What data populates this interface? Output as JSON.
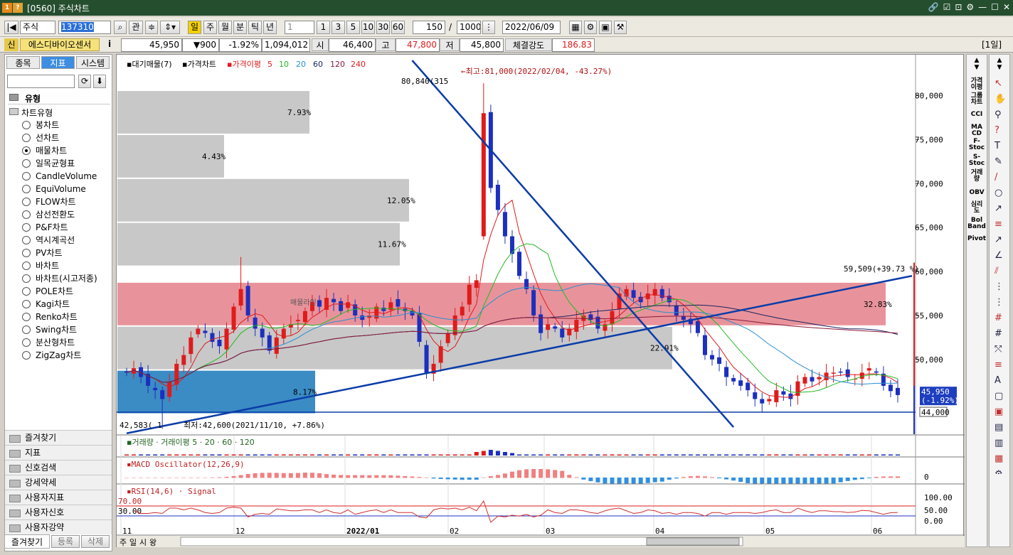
{
  "window": {
    "title": "[0560] 주식차트"
  },
  "toolbar": {
    "market": "주식",
    "code": "137310",
    "btn_gwan": "관",
    "periods": [
      "일",
      "주",
      "월",
      "분",
      "틱",
      "년"
    ],
    "unit_value": "1",
    "quick_units": [
      "1",
      "3",
      "5",
      "10",
      "30",
      "60"
    ],
    "count": "150",
    "total": "1000",
    "date": "2022/06/09"
  },
  "quote": {
    "badge": "신",
    "name": "에스디바이오센서",
    "info": "i",
    "price": "45,950",
    "change": "▼900",
    "change_pct": "-1.92%",
    "volume": "1,094,012",
    "open_label": "시",
    "open": "46,400",
    "high_label": "고",
    "high": "47,800",
    "low_label": "저",
    "low": "45,800",
    "strength_label": "체결강도",
    "strength": "186.83",
    "period_tag": "[1일]"
  },
  "sidebar": {
    "tabs": [
      "종목",
      "지표",
      "시스템"
    ],
    "section": "유형",
    "subsection": "차트유형",
    "chart_types": [
      "봉차트",
      "선차트",
      "매물차트",
      "일목균형표",
      "CandleVolume",
      "EquiVolume",
      "FLOW차트",
      "삼선전환도",
      "P&F차트",
      "역시계곡선",
      "PV차트",
      "바차트",
      "바차트(시고저종)",
      "POLE차트",
      "Kagi차트",
      "Renko차트",
      "Swing차트",
      "분산형차트",
      "ZigZag차트"
    ],
    "selected_index": 2,
    "folders": [
      "즐겨찾기",
      "지표",
      "신호검색",
      "강세약세",
      "사용자지표",
      "사용자신호",
      "사용자강약"
    ],
    "bottom_buttons": [
      "즐겨찾기",
      "등록",
      "삭제"
    ]
  },
  "chart_data": {
    "type": "candlestick",
    "legend": {
      "vp": "대기매물(7)",
      "price": "가격차트",
      "ma": "가격이평",
      "ma_periods": [
        "5",
        "10",
        "20",
        "60",
        "120",
        "240"
      ]
    },
    "y_ticks": [
      "80,000",
      "75,000",
      "70,000",
      "65,000",
      "60,000",
      "55,000",
      "50,000"
    ],
    "ylim": [
      41500,
      84000
    ],
    "x_labels": [
      "11",
      "12",
      "2022/01",
      "02",
      "03",
      "04",
      "05",
      "06"
    ],
    "volume_profile": [
      {
        "low": 75600,
        "high": 80600,
        "pct": "7.93%"
      },
      {
        "low": 70600,
        "high": 75600,
        "pct": "4.43%"
      },
      {
        "low": 65600,
        "high": 70600,
        "pct": "12.05%"
      },
      {
        "low": 60600,
        "high": 65600,
        "pct": "11.67%"
      },
      {
        "low": 53800,
        "high": 58800,
        "pct": "32.83%"
      },
      {
        "low": 48800,
        "high": 53800,
        "pct": "22.91%"
      },
      {
        "low": 43800,
        "high": 48800,
        "pct": "8.17%"
      }
    ],
    "annotations": {
      "high": "←최고:81,000(2022/02/04, -43.27%)",
      "high_left": "80,840(315",
      "low": "최저:42,600(2021/11/10, +7.86%)",
      "low_left": "42,583( 1",
      "trend_value": "59,509(+39.73 %)",
      "price_tag": "45,950",
      "price_tag_pct": "(-1.92%)",
      "line_value": "44,000",
      "inner_label": "매물라인"
    },
    "close": [
      48500,
      49000,
      48000,
      47000,
      46500,
      45500,
      47500,
      49500,
      50500,
      52500,
      53500,
      53000,
      52000,
      51500,
      53500,
      56000,
      58000,
      55000,
      53500,
      52500,
      51000,
      52500,
      53500,
      54000,
      54500,
      55500,
      56500,
      56000,
      57000,
      56500,
      55500,
      56500,
      55000,
      54500,
      55000,
      56000,
      55500,
      56500,
      56000,
      55500,
      55000,
      52000,
      48500,
      49500,
      51500,
      53000,
      55000,
      56000,
      58500,
      59000,
      78000,
      69500,
      67000,
      64000,
      62000,
      59500,
      58000,
      55000,
      53000,
      54000,
      53500,
      52500,
      53500,
      54500,
      55000,
      54500,
      53500,
      54000,
      55500,
      57500,
      58000,
      57000,
      56500,
      57500,
      58000,
      57000,
      56500,
      55000,
      54500,
      54000,
      53000,
      50500,
      50000,
      49500,
      48000,
      47500,
      47000,
      46500,
      45500,
      45000,
      45500,
      46500,
      46000,
      45500,
      47500,
      48000,
      47500,
      48000,
      48500,
      48500,
      48500,
      48000,
      47800,
      48500,
      49000,
      48500,
      47000,
      46400,
      45950
    ],
    "sub_panels": {
      "volume": "거래량 · 거래이평 5 · 20 · 60 · 120",
      "macd": "MACD Oscillator(12,26,9)",
      "macd_zero": "0",
      "rsi": "RSI(14,6) · Signal",
      "rsi_levels": [
        "70.00",
        "30.00"
      ],
      "rsi_ticks": [
        "100.00",
        "50.00",
        "0.00"
      ]
    }
  },
  "colors": {
    "up": "#e01b1b",
    "down": "#1c2fbf",
    "accent": "#3d8de0",
    "titlebar": "#254e2e"
  }
}
